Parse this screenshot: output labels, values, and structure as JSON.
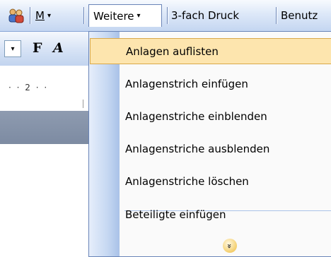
{
  "toolbar": {
    "people_icon": "people-icon",
    "m_menu_label": "M",
    "m_menu_arrow": "▾",
    "weitere_label": "Weitere",
    "weitere_arrow": "▾",
    "dreifach_label": "3-fach Druck",
    "benutz_label": "Benutz"
  },
  "format_toolbar": {
    "combo_arrow": "▾",
    "bold_label": "F",
    "italic_label": "A"
  },
  "ruler": {
    "text": "· · 2 · ·"
  },
  "menu": {
    "items": [
      {
        "label": "Anlagen auflisten",
        "state": "hover"
      },
      {
        "label": "Anlagenstrich einfügen"
      },
      {
        "label": "Anlagenstriche einblenden"
      },
      {
        "label": "Anlagenstriche ausblenden"
      },
      {
        "label": "Anlagenstriche löschen"
      },
      {
        "label": "Beteiligte einfügen"
      }
    ],
    "expand_icon": "chevron-double-down-icon",
    "expand_glyph": "»"
  },
  "colors": {
    "highlight": "#fde5ae",
    "highlight_border": "#d9a84a",
    "gutter": "#c6d8f2",
    "toolbar": "#dde8f8"
  }
}
